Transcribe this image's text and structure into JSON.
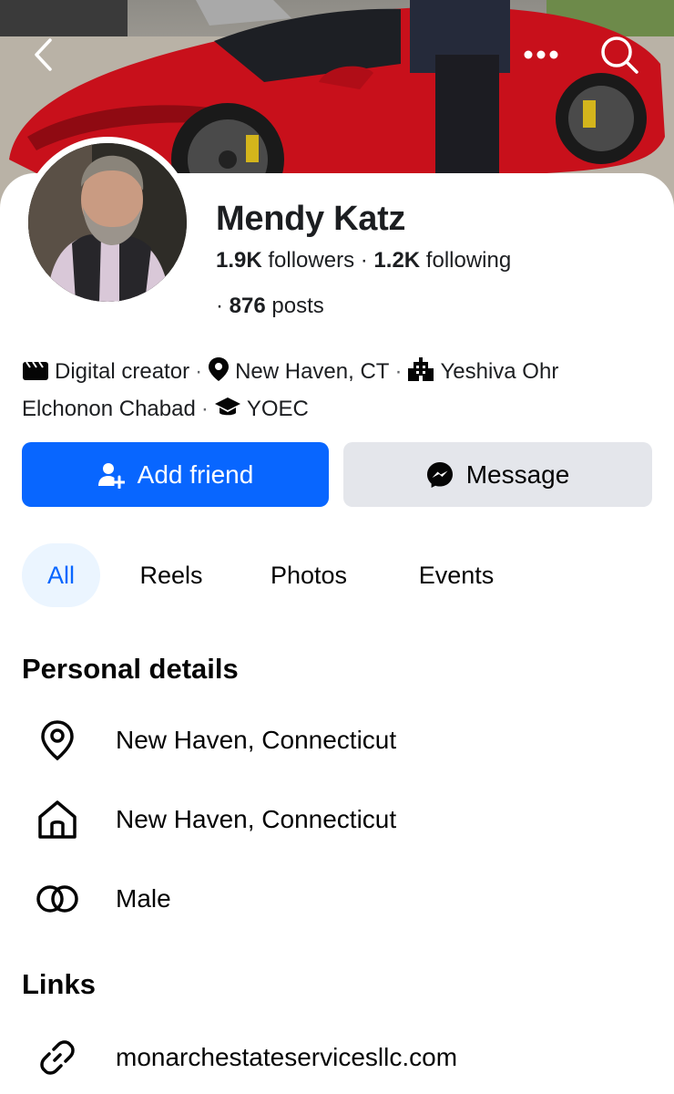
{
  "profile": {
    "name": "Mendy Katz",
    "followers_count": "1.9K",
    "followers_label": "followers",
    "following_count": "1.2K",
    "following_label": "following",
    "posts_count": "876",
    "posts_label": "posts"
  },
  "intro": {
    "category": "Digital creator",
    "location": "New Haven, CT",
    "workplace_line1": "Yeshiva Ohr",
    "workplace_line2": "Elchonon Chabad",
    "education": "YOEC"
  },
  "actions": {
    "add_friend_label": "Add friend",
    "message_label": "Message"
  },
  "tabs": [
    {
      "label": "All",
      "active": true
    },
    {
      "label": "Reels",
      "active": false
    },
    {
      "label": "Photos",
      "active": false
    },
    {
      "label": "Events",
      "active": false
    }
  ],
  "personal_details": {
    "title": "Personal details",
    "current_city": "New Haven, Connecticut",
    "hometown": "New Haven, Connecticut",
    "gender": "Male"
  },
  "links": {
    "title": "Links",
    "website": "monarchestateservicesllc.com"
  },
  "icons": {
    "back": "chevron-left-icon",
    "more": "more-dots-icon",
    "search": "search-icon",
    "category": "clapperboard-icon",
    "location": "location-pin-icon",
    "workplace": "building-icon",
    "education": "graduation-cap-icon",
    "add_friend": "add-person-icon",
    "messenger": "messenger-icon",
    "current_city": "location-pin-outline-icon",
    "hometown": "home-icon",
    "gender": "gender-rings-icon",
    "link": "link-icon"
  },
  "colors": {
    "primary": "#0866ff",
    "secondary_button": "#e4e6eb",
    "active_tab_bg": "#ebf5ff",
    "text": "#050505",
    "car_red": "#c8101b"
  }
}
